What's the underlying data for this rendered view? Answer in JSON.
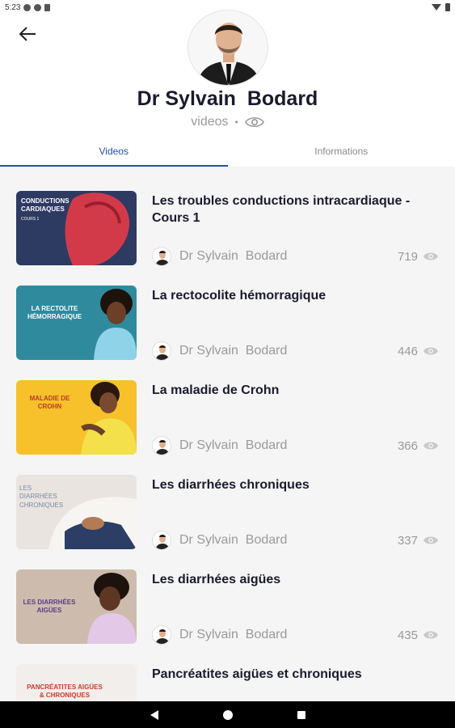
{
  "status": {
    "time": "5:23"
  },
  "profile": {
    "name": "Dr Sylvain  Bodard",
    "videos_label": "videos",
    "separator": "•"
  },
  "tabs": [
    {
      "label": "Videos",
      "active": true
    },
    {
      "label": "Informations",
      "active": false
    }
  ],
  "videos": [
    {
      "title": "Les troubles conductions intracardiaque - Cours 1",
      "author": "Dr Sylvain  Bodard",
      "views": "719",
      "thumb_text": "CONDUCTIONS CARDIAQUES",
      "thumb_sub": "COURS 1"
    },
    {
      "title": "La rectocolite hémorragique",
      "author": "Dr Sylvain  Bodard",
      "views": "446",
      "thumb_text": "LA RECTOLITE HÉMORRAGIQUE"
    },
    {
      "title": "La maladie de Crohn",
      "author": "Dr Sylvain  Bodard",
      "views": "366",
      "thumb_text": "MALADIE DE CROHN"
    },
    {
      "title": "Les diarrhées chroniques",
      "author": "Dr Sylvain  Bodard",
      "views": "337",
      "thumb_text": "LES DIARRHÉES CHRONIQUES"
    },
    {
      "title": "Les diarrhées aigües",
      "author": "Dr Sylvain  Bodard",
      "views": "435",
      "thumb_text": "LES DIARRHÉES AIGÜES"
    },
    {
      "title": "Pancréatites aigües et chroniques",
      "author": "",
      "views": "",
      "thumb_text": "PANCRÉATITES AIGÜES & CHRONIQUES"
    }
  ],
  "colors": {
    "accent": "#1f4fb3",
    "text_dark": "#1a1a2e",
    "muted": "#9a9a9a"
  },
  "icons": {
    "back": "arrow-left-icon",
    "eye": "eye-icon",
    "nav": [
      "back-triangle-icon",
      "home-circle-icon",
      "recents-square-icon"
    ]
  }
}
